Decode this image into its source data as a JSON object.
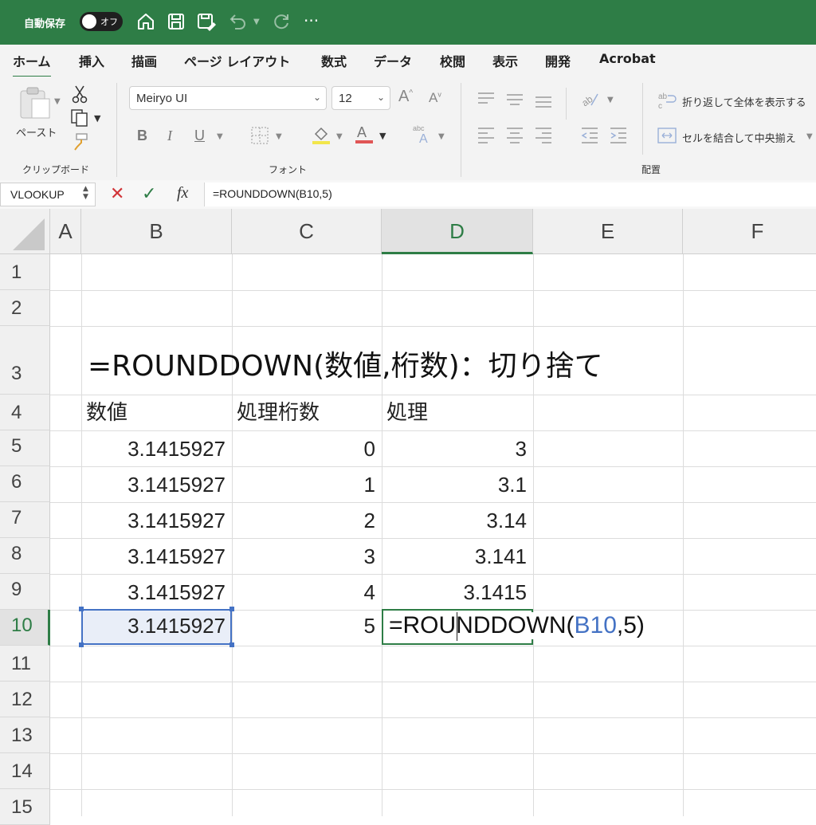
{
  "titlebar": {
    "autosave_label": "自動保存",
    "toggle_text": "オフ",
    "icons": [
      "home-icon",
      "save-icon",
      "save-as-icon",
      "undo-icon",
      "redo-icon",
      "more-icon"
    ],
    "more_label": "···",
    "color": "#2e7d46"
  },
  "tabs": [
    "ホーム",
    "挿入",
    "描画",
    "ページ レイアウト",
    "数式",
    "データ",
    "校閲",
    "表示",
    "開発",
    "Acrobat"
  ],
  "ribbon": {
    "paste_label": "ペースト",
    "clipboard_group": "クリップボード",
    "font_group": "フォント",
    "align_group": "配置",
    "font_name": "Meiryo UI",
    "font_size": "12",
    "bold": "B",
    "italic": "I",
    "underline": "U",
    "wrap_text": "折り返して全体を表示する",
    "merge_center": "セルを結合して中央揃え"
  },
  "formula_bar": {
    "name_box": "VLOOKUP",
    "fx": "fx",
    "formula": "=ROUNDDOWN(B10,5)"
  },
  "columns": [
    "A",
    "B",
    "C",
    "D",
    "E",
    "F"
  ],
  "rows": [
    "1",
    "2",
    "3",
    "4",
    "5",
    "6",
    "7",
    "8",
    "9",
    "10",
    "11",
    "12",
    "13",
    "14",
    "15"
  ],
  "sheet": {
    "title": "=ROUNDDOWN(数値,桁数)：切り捨て",
    "headers": {
      "b": "数値",
      "c": "処理桁数",
      "d": "処理"
    },
    "data": [
      {
        "value": "3.1415927",
        "digits": "0",
        "result": "3"
      },
      {
        "value": "3.1415927",
        "digits": "1",
        "result": "3.1"
      },
      {
        "value": "3.1415927",
        "digits": "2",
        "result": "3.14"
      },
      {
        "value": "3.1415927",
        "digits": "3",
        "result": "3.141"
      },
      {
        "value": "3.1415927",
        "digits": "4",
        "result": "3.1415"
      }
    ],
    "row10": {
      "value": "3.1415927",
      "digits": "5",
      "edit_prefix": "=ROUNDDOWN(",
      "edit_ref": "B10",
      "edit_suffix": ",5)"
    }
  }
}
